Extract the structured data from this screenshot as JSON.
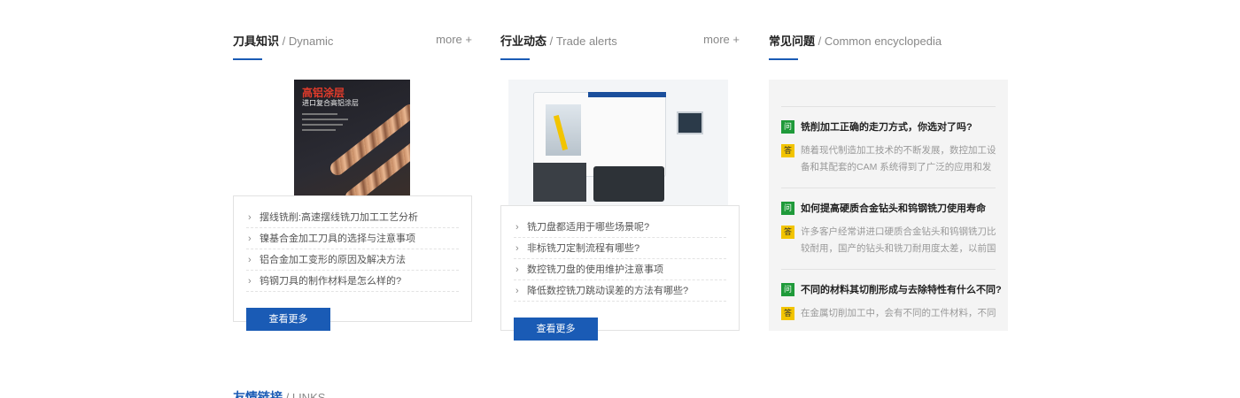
{
  "sections": {
    "knowledge": {
      "title": "刀具知识",
      "subtitle": " / Dynamic",
      "more": "more +",
      "image": {
        "headline": "高铝涂层",
        "subline": "进口复合高铝涂层"
      },
      "items": [
        "摆线铣削:高速摆线铣刀加工工艺分析",
        "镍基合金加工刀具的选择与注意事项",
        "铝合金加工变形的原因及解决方法",
        "钨钢刀具的制作材料是怎么样的?"
      ],
      "button": "查看更多"
    },
    "industry": {
      "title": "行业动态",
      "subtitle": " / Trade alerts",
      "more": "more +",
      "items": [
        "铣刀盘都适用于哪些场景呢?",
        "非标铣刀定制流程有哪些?",
        "数控铣刀盘的使用维护注意事项",
        "降低数控铣刀跳动误差的方法有哪些?"
      ],
      "button": "查看更多"
    },
    "faq": {
      "title": "常见问题",
      "subtitle": " / Common encyclopedia",
      "q_badge": "问",
      "a_badge": "答",
      "items": [
        {
          "q": "铣削加工正确的走刀方式，你选对了吗?",
          "a": "随着现代制造加工技术的不断发展，数控加工设备和其配套的CAM 系统得到了广泛的应用和发"
        },
        {
          "q": "如何提高硬质合金钻头和钨钢铣刀使用寿命",
          "a": "许多客户经常讲进口硬质合金钻头和钨钢铣刀比较耐用，国产的钻头和铣刀耐用度太差，以前国"
        },
        {
          "q": "不同的材料其切削形成与去除特性有什么不同?",
          "a": "在金属切削加工中，会有不同的工件材料，不同"
        }
      ]
    },
    "links": {
      "title": "友情链接",
      "subtitle": " / LINKS"
    }
  },
  "colors": {
    "accent": "#1a5bb5",
    "q_badge": "#1f9a3a",
    "a_badge": "#f2c400"
  }
}
